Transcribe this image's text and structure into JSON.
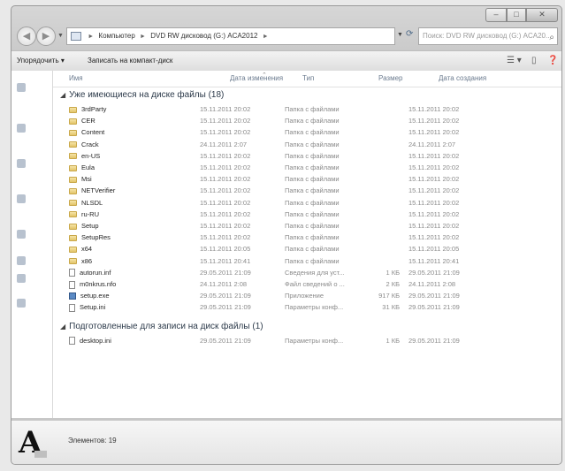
{
  "window": {
    "caption": {
      "minimize": "–",
      "maximize": "□",
      "close": "✕"
    }
  },
  "nav": {
    "back_glyph": "◀",
    "forward_glyph": "▶",
    "address_crumbs": [
      "Компьютер",
      "DVD RW дисковод (G:) ACA2012"
    ],
    "search_placeholder": "Поиск: DVD RW дисковод (G:) ACA20..."
  },
  "toolbar": {
    "organize": "Упорядочить ▾",
    "burn": "Записать на компакт-диск"
  },
  "columns": {
    "name": "Имя",
    "modified": "Дата изменения",
    "type": "Тип",
    "size": "Размер",
    "created": "Дата создания"
  },
  "groups": [
    {
      "title": "Уже имеющиеся на диске файлы (18)",
      "rows": [
        {
          "icon": "folder",
          "name": "3rdParty",
          "modified": "15.11.2011 20:02",
          "type": "Папка с файлами",
          "size": "",
          "created": "15.11.2011 20:02"
        },
        {
          "icon": "folder",
          "name": "CER",
          "modified": "15.11.2011 20:02",
          "type": "Папка с файлами",
          "size": "",
          "created": "15.11.2011 20:02"
        },
        {
          "icon": "folder",
          "name": "Content",
          "modified": "15.11.2011 20:02",
          "type": "Папка с файлами",
          "size": "",
          "created": "15.11.2011 20:02"
        },
        {
          "icon": "folder",
          "name": "Crack",
          "modified": "24.11.2011 2:07",
          "type": "Папка с файлами",
          "size": "",
          "created": "24.11.2011 2:07"
        },
        {
          "icon": "folder",
          "name": "en-US",
          "modified": "15.11.2011 20:02",
          "type": "Папка с файлами",
          "size": "",
          "created": "15.11.2011 20:02"
        },
        {
          "icon": "folder",
          "name": "Eula",
          "modified": "15.11.2011 20:02",
          "type": "Папка с файлами",
          "size": "",
          "created": "15.11.2011 20:02"
        },
        {
          "icon": "folder",
          "name": "Msi",
          "modified": "15.11.2011 20:02",
          "type": "Папка с файлами",
          "size": "",
          "created": "15.11.2011 20:02"
        },
        {
          "icon": "folder",
          "name": "NETVerifier",
          "modified": "15.11.2011 20:02",
          "type": "Папка с файлами",
          "size": "",
          "created": "15.11.2011 20:02"
        },
        {
          "icon": "folder",
          "name": "NLSDL",
          "modified": "15.11.2011 20:02",
          "type": "Папка с файлами",
          "size": "",
          "created": "15.11.2011 20:02"
        },
        {
          "icon": "folder",
          "name": "ru-RU",
          "modified": "15.11.2011 20:02",
          "type": "Папка с файлами",
          "size": "",
          "created": "15.11.2011 20:02"
        },
        {
          "icon": "folder",
          "name": "Setup",
          "modified": "15.11.2011 20:02",
          "type": "Папка с файлами",
          "size": "",
          "created": "15.11.2011 20:02"
        },
        {
          "icon": "folder",
          "name": "SetupRes",
          "modified": "15.11.2011 20:02",
          "type": "Папка с файлами",
          "size": "",
          "created": "15.11.2011 20:02"
        },
        {
          "icon": "folder",
          "name": "x64",
          "modified": "15.11.2011 20:05",
          "type": "Папка с файлами",
          "size": "",
          "created": "15.11.2011 20:05"
        },
        {
          "icon": "folder",
          "name": "x86",
          "modified": "15.11.2011 20:41",
          "type": "Папка с файлами",
          "size": "",
          "created": "15.11.2011 20:41"
        },
        {
          "icon": "doc",
          "name": "autorun.inf",
          "modified": "29.05.2011 21:09",
          "type": "Сведения для уст...",
          "size": "1 КБ",
          "created": "29.05.2011 21:09"
        },
        {
          "icon": "doc",
          "name": "m0nkrus.nfo",
          "modified": "24.11.2011 2:08",
          "type": "Файл сведений о ...",
          "size": "2 КБ",
          "created": "24.11.2011 2:08"
        },
        {
          "icon": "app",
          "name": "setup.exe",
          "modified": "29.05.2011 21:09",
          "type": "Приложение",
          "size": "917 КБ",
          "created": "29.05.2011 21:09"
        },
        {
          "icon": "doc",
          "name": "Setup.ini",
          "modified": "29.05.2011 21:09",
          "type": "Параметры конф...",
          "size": "31 КБ",
          "created": "29.05.2011 21:09"
        }
      ]
    },
    {
      "title": "Подготовленные для записи на диск файлы (1)",
      "rows": [
        {
          "icon": "doc",
          "name": "desktop.ini",
          "modified": "29.05.2011 21:09",
          "type": "Параметры конф...",
          "size": "1 КБ",
          "created": "29.05.2011 21:09"
        }
      ]
    }
  ],
  "details": {
    "count_label": "Элементов: 19",
    "icon_glyph": "A"
  }
}
